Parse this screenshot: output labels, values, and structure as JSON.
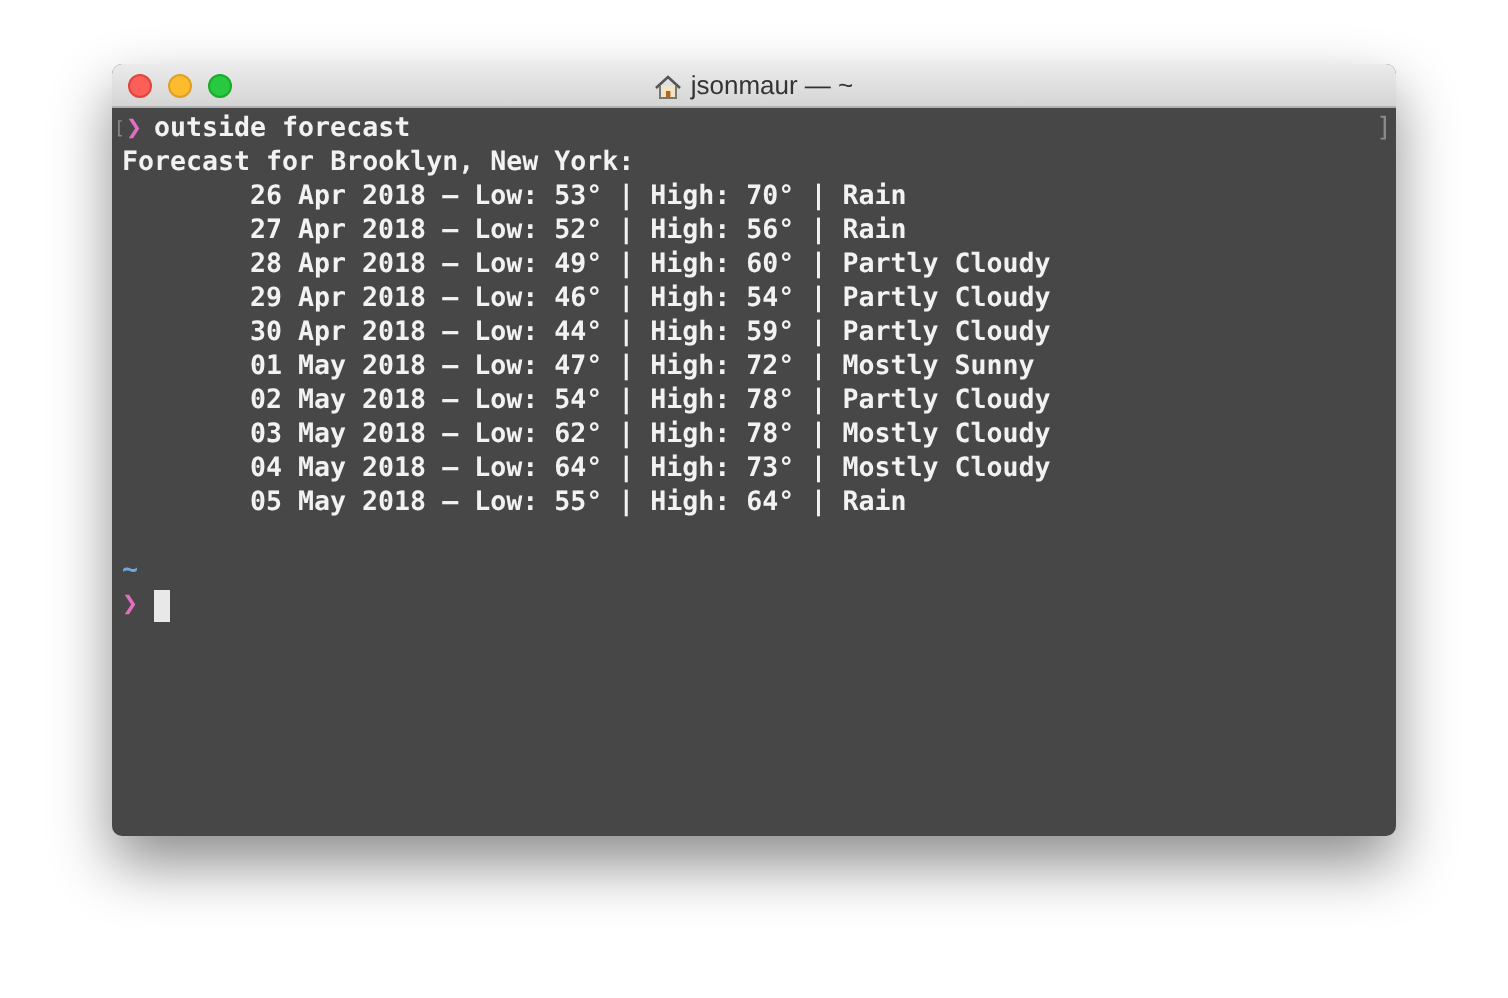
{
  "window": {
    "title": "jsonmaur — ~"
  },
  "terminal": {
    "left_mark": "[",
    "right_mark": "]",
    "command": {
      "prompt": "❯",
      "text": "outside forecast"
    },
    "heading": "Forecast for Brooklyn, New York:",
    "rows": [
      "26 Apr 2018 – Low: 53° | High: 70° | Rain",
      "27 Apr 2018 – Low: 52° | High: 56° | Rain",
      "28 Apr 2018 – Low: 49° | High: 60° | Partly Cloudy",
      "29 Apr 2018 – Low: 46° | High: 54° | Partly Cloudy",
      "30 Apr 2018 – Low: 44° | High: 59° | Partly Cloudy",
      "01 May 2018 – Low: 47° | High: 72° | Mostly Sunny",
      "02 May 2018 – Low: 54° | High: 78° | Partly Cloudy",
      "03 May 2018 – Low: 62° | High: 78° | Mostly Cloudy",
      "04 May 2018 – Low: 64° | High: 73° | Mostly Cloudy",
      "05 May 2018 – Low: 55° | High: 64° | Rain"
    ],
    "cwd": "~",
    "prompt": "❯"
  }
}
